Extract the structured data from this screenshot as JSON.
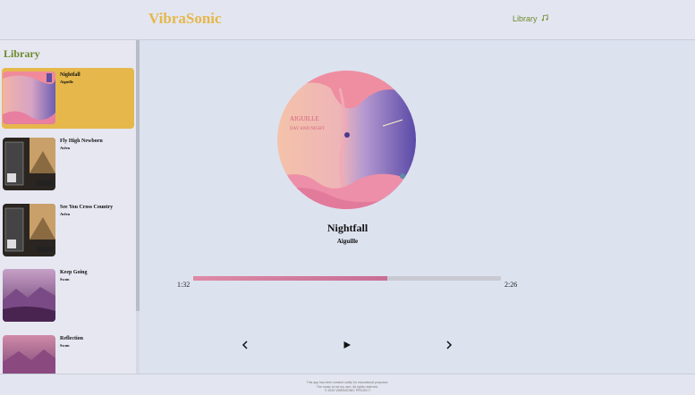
{
  "header": {
    "brand": "VibraSonic",
    "nav_library": "Library",
    "nav_icon": "music-note-icon"
  },
  "sidebar": {
    "title": "Library",
    "items": [
      {
        "title": "Nightfall",
        "artist": "Aiguille",
        "active": true,
        "art": "pink-purple"
      },
      {
        "title": "Fly High Newborn",
        "artist": "Avfen",
        "active": false,
        "art": "dark-cassette"
      },
      {
        "title": "See You Cross Country",
        "artist": "Avfen",
        "active": false,
        "art": "dark-cassette"
      },
      {
        "title": "Keep Going",
        "artist": "Swøn",
        "active": false,
        "art": "purple-landscape"
      },
      {
        "title": "Reflection",
        "artist": "Swøn",
        "active": false,
        "art": "purple-landscape"
      }
    ]
  },
  "player": {
    "title": "Nightfall",
    "artist": "Aiguille",
    "album_text_1": "AIGUILLE",
    "album_text_2": "DAY AND NIGHT",
    "current_time": "1:32",
    "duration": "2:26",
    "progress": 0.63,
    "prev_icon": "chevron-left-icon",
    "play_icon": "play-icon",
    "next_icon": "chevron-right-icon"
  },
  "footer": {
    "line1": "This app has been created solely for educational purposes.",
    "line2": "The music is not my own. All rights reserved.",
    "line3": "© 2023 VIBRASONIC PROJECT"
  },
  "colors": {
    "brand": "#e6b84b",
    "accent_green": "#6d8a2c",
    "active_item": "#e6b84b",
    "background": "#dde2ef",
    "progress_start": "#dd8aa5",
    "progress_end": "#c86e95"
  }
}
